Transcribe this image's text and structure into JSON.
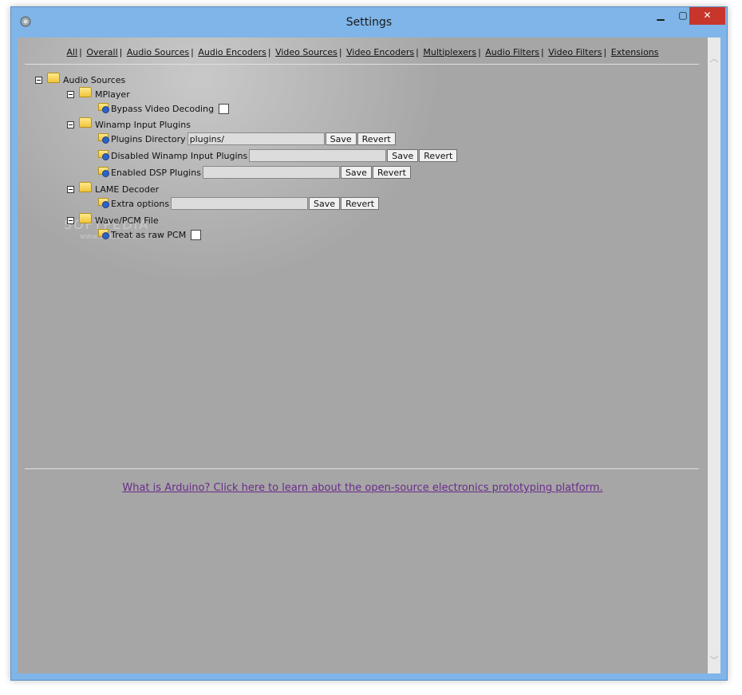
{
  "window": {
    "title": "Settings"
  },
  "titlebar": {
    "minimize": "▁",
    "maximize": "▢",
    "close": "✕"
  },
  "nav": {
    "links": [
      "All",
      "Overall",
      "Audio Sources",
      "Audio Encoders",
      "Video Sources",
      "Video Encoders",
      "Multiplexers",
      "Audio Filters",
      "Video Filters",
      "Extensions"
    ],
    "separator": "|"
  },
  "tree": {
    "root": "Audio Sources",
    "mplayer": {
      "label": "MPlayer",
      "bypass_label": "Bypass Video Decoding"
    },
    "winamp": {
      "label": "Winamp Input Plugins",
      "plugins_dir_label": "Plugins Directory",
      "plugins_dir_value": "plugins/",
      "disabled_label": "Disabled Winamp Input Plugins",
      "disabled_value": "",
      "dsp_label": "Enabled DSP Plugins",
      "dsp_value": ""
    },
    "lame": {
      "label": "LAME Decoder",
      "extra_label": "Extra options",
      "extra_value": ""
    },
    "wave": {
      "label": "Wave/PCM File",
      "raw_label": "Treat as raw PCM"
    }
  },
  "buttons": {
    "save": "Save",
    "revert": "Revert"
  },
  "footer": {
    "link_text": "What is Arduino? Click here to learn about the open-source electronics prototyping platform."
  },
  "watermark": {
    "brand": "SOFTPEDIA",
    "url": "www.softpedia.com"
  },
  "colors": {
    "background": "#a6a6a6",
    "link": "#6a2c8a",
    "close_button": "#c7352b",
    "frame": "#7fb5e8"
  }
}
